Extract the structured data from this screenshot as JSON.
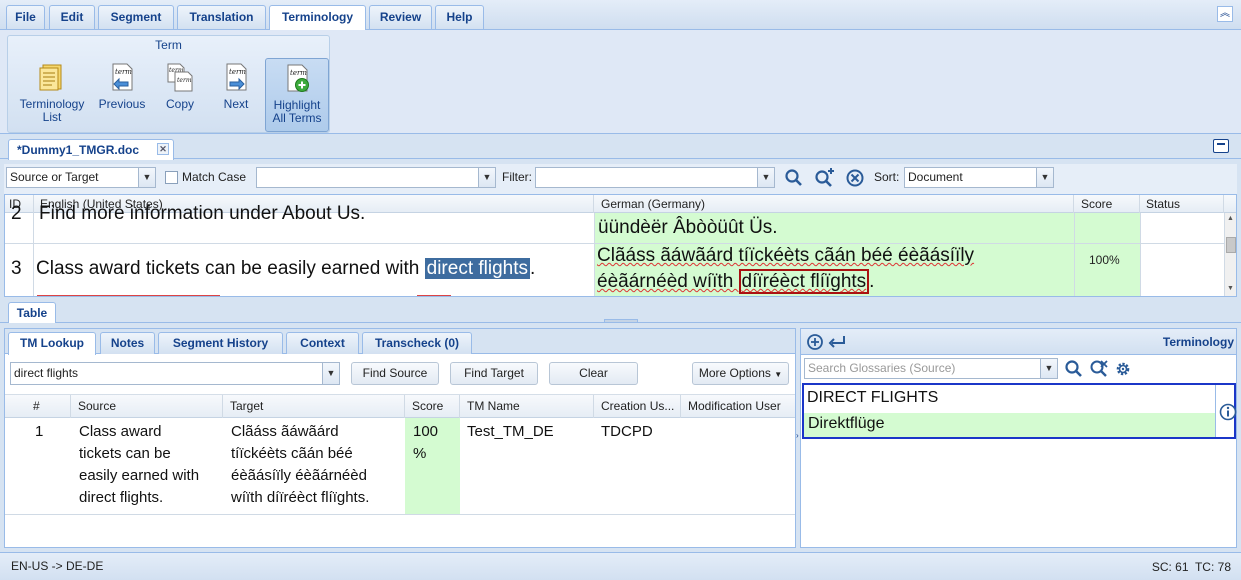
{
  "menu": {
    "tabs": [
      {
        "label": "File"
      },
      {
        "label": "Edit"
      },
      {
        "label": "Segment"
      },
      {
        "label": "Translation"
      },
      {
        "label": "Terminology"
      },
      {
        "label": "Review"
      },
      {
        "label": "Help"
      }
    ],
    "active": "Terminology"
  },
  "ribbon": {
    "group_title": "Term",
    "buttons": [
      {
        "label_line1": "Terminology",
        "label_line2": "List",
        "icon": "terminology-list-icon"
      },
      {
        "label_line1": "Previous",
        "label_line2": "",
        "icon": "term-previous-icon"
      },
      {
        "label_line1": "Copy",
        "label_line2": "",
        "icon": "term-copy-icon"
      },
      {
        "label_line1": "Next",
        "label_line2": "",
        "icon": "term-next-icon"
      },
      {
        "label_line1": "Highlight",
        "label_line2": "All Terms",
        "icon": "term-highlight-icon"
      }
    ]
  },
  "document": {
    "tab_label": "*Dummy1_TMGR.doc"
  },
  "filterbar": {
    "scope_value": "Source or Target",
    "match_case_label": "Match Case",
    "search_value": "",
    "filter_label": "Filter:",
    "filter_value": "",
    "sort_label": "Sort:",
    "sort_value": "Document"
  },
  "grid": {
    "headers": {
      "id": "ID",
      "source": "English (United States)",
      "target": "German (Germany)",
      "score": "Score",
      "status": "Status"
    },
    "rows": [
      {
        "id": "2",
        "source": "Find more information under About Us.",
        "target": "üündèër Âbòòüût Üs.",
        "score": ""
      },
      {
        "id": "3",
        "source_before": "Class award tickets can be easily earned with ",
        "source_highlight": "direct flights",
        "source_after": ".",
        "target_line1": "Clãáss ãáwãárd tíïckéèts cãán béé éèãásíïly",
        "target_line2_before": "éèãárnéèd wíïth ",
        "target_line2_highlight": "díïréèct flíïghts",
        "target_line2_after": ".",
        "score": "100%"
      }
    ]
  },
  "table_tab": {
    "label": "Table"
  },
  "tm_panel": {
    "tabs": [
      {
        "label": "TM Lookup"
      },
      {
        "label": "Notes"
      },
      {
        "label": "Segment History"
      },
      {
        "label": "Context"
      },
      {
        "label": "Transcheck (0)"
      }
    ],
    "query_value": "direct flights",
    "find_source_label": "Find Source",
    "find_target_label": "Find Target",
    "clear_label": "Clear",
    "more_options_label": "More Options",
    "columns": [
      "#",
      "Source",
      "Target",
      "Score",
      "TM Name",
      "Creation Us...",
      "Modification User"
    ],
    "rows": [
      {
        "num": "1",
        "source": [
          "Class award",
          "tickets can be",
          "easily earned with",
          "direct flights."
        ],
        "target": [
          "Clãáss ãáwãárd",
          "tíïckéèts cãán béé",
          "éèãásíïly éèãárnéèd",
          "wíïth díïréèct flíïghts."
        ],
        "score": [
          "100",
          "%"
        ],
        "tm_name": "Test_TM_DE",
        "creation_user": "TDCPD",
        "modification_user": ""
      }
    ]
  },
  "terminology_panel": {
    "title": "Terminology",
    "search_placeholder": "Search Glossaries (Source)",
    "term_source": "DIRECT FLIGHTS",
    "term_target": "Direktflüge"
  },
  "status": {
    "language_pair": "EN-US -> DE-DE",
    "counts": "SC: 61  TC: 78"
  },
  "colors": {
    "accent": "#15428b",
    "target_bg": "#d4fbd1",
    "source_highlight": "#3e6c9f",
    "term_box_border": "#1b36c8"
  }
}
